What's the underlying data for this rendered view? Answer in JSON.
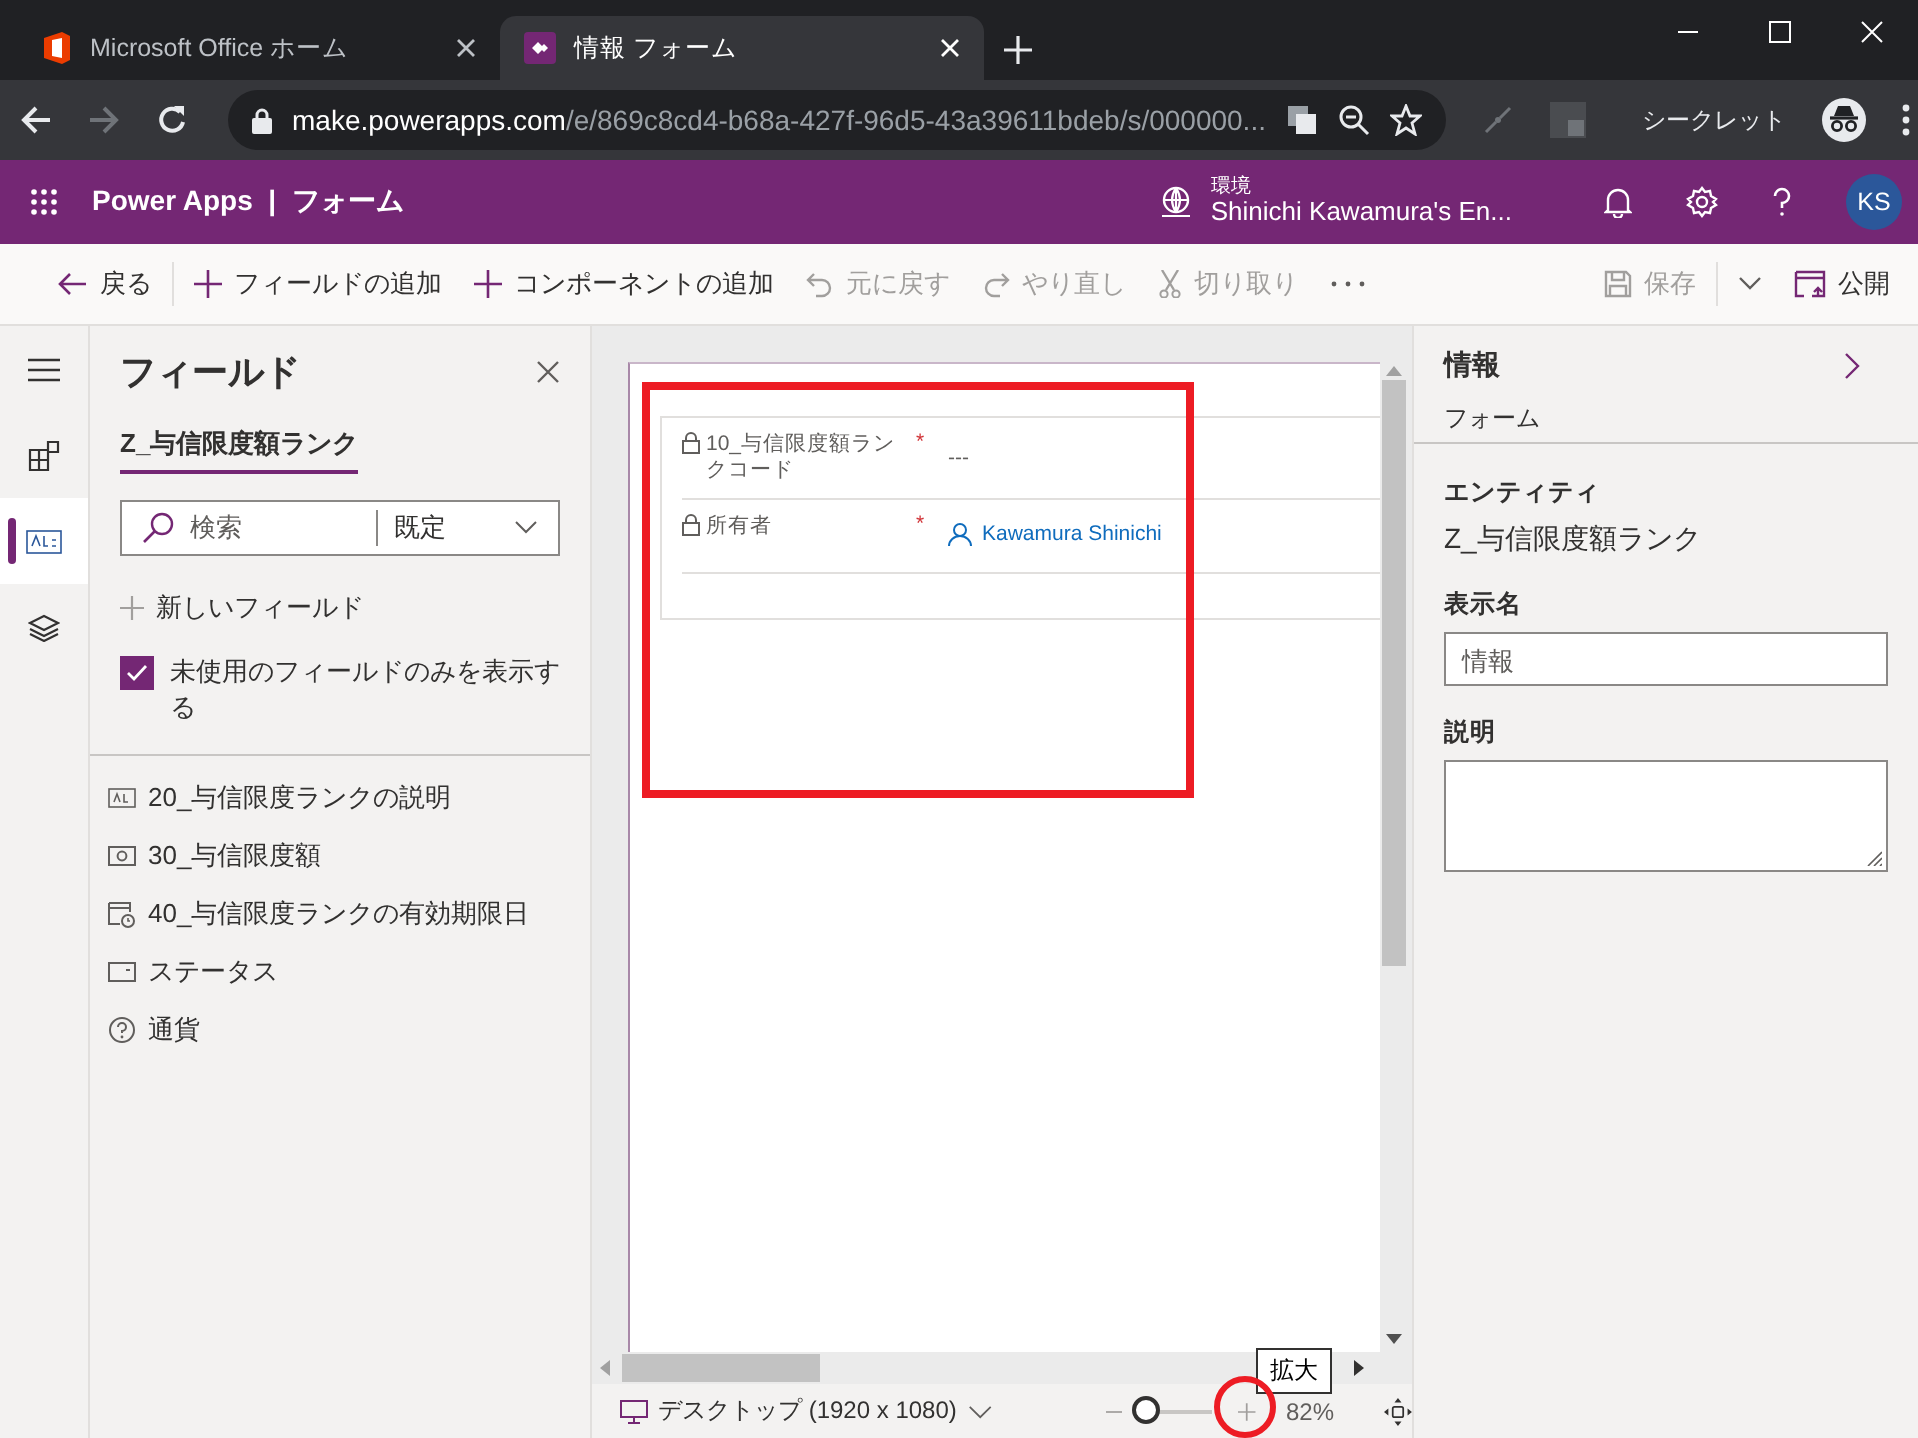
{
  "browser": {
    "tabs": [
      {
        "title": "Microsoft Office ホーム",
        "kind": "office",
        "selected": false
      },
      {
        "title": "情報 フォーム",
        "kind": "powerapps",
        "selected": true
      }
    ],
    "url_host": "make.powerapps.com",
    "url_path": "/e/869c8cd4-b68a-427f-96d5-43a39611bdeb/s/000000...",
    "incognito_label": "シークレット"
  },
  "app_header": {
    "app_name": "Power Apps",
    "separator": "|",
    "page_title": "フォーム",
    "environment_label": "環境",
    "environment_name": "Shinichi Kawamura's En...",
    "avatar_initials": "KS"
  },
  "command_bar": {
    "left": [
      {
        "label": "戻る",
        "kind": "back",
        "disabled": false
      },
      {
        "label": "フィールドの追加",
        "kind": "add",
        "disabled": false
      },
      {
        "label": "コンポーネントの追加",
        "kind": "add",
        "disabled": false
      },
      {
        "label": "元に戻す",
        "kind": "undo",
        "disabled": true
      },
      {
        "label": "やり直し",
        "kind": "redo",
        "disabled": true
      },
      {
        "label": "切り取り",
        "kind": "cut",
        "disabled": true
      }
    ],
    "right": [
      {
        "label": "保存",
        "kind": "save",
        "disabled": true
      },
      {
        "label": "公開",
        "kind": "publish",
        "disabled": false
      }
    ]
  },
  "rail": [
    {
      "kind": "components",
      "selected": false
    },
    {
      "kind": "fields",
      "selected": true
    },
    {
      "kind": "layers",
      "selected": false
    }
  ],
  "fields_panel": {
    "title": "フィールド",
    "table_tab": "Z_与信限度額ランク",
    "search_placeholder": "検索",
    "filter": "既定",
    "new_field": "新しいフィールド",
    "unused_only": {
      "label": "未使用のフィールドのみを表示する",
      "checked": true
    },
    "fields": [
      {
        "label": "20_与信限度ランクの説明",
        "kind": "text"
      },
      {
        "label": "30_与信限度額",
        "kind": "currency"
      },
      {
        "label": "40_与信限度ランクの有効期限日",
        "kind": "date"
      },
      {
        "label": "ステータス",
        "kind": "option"
      },
      {
        "label": "通貨",
        "kind": "unknown"
      }
    ]
  },
  "form": {
    "required_mark": "*",
    "rows": [
      {
        "label": "10_与信限度額ランクコード",
        "required": true,
        "locked": true,
        "value": "---",
        "kind": "text"
      },
      {
        "label": "所有者",
        "required": true,
        "locked": true,
        "value": "Kawamura Shinichi",
        "kind": "user"
      }
    ]
  },
  "properties": {
    "title": "情報",
    "subtitle": "フォーム",
    "entity_label": "エンティティ",
    "entity_value": "Z_与信限度額ランク",
    "display_name_label": "表示名",
    "display_name_value": "情報",
    "description_label": "説明"
  },
  "status_bar": {
    "device": "デスクトップ (1920 x 1080)",
    "zoom": {
      "level": 0.05
    },
    "zoom_percent": "82%",
    "tooltip": "拡大"
  },
  "annotations": [
    {
      "kind": "rectangle"
    },
    {
      "kind": "circle"
    }
  ]
}
